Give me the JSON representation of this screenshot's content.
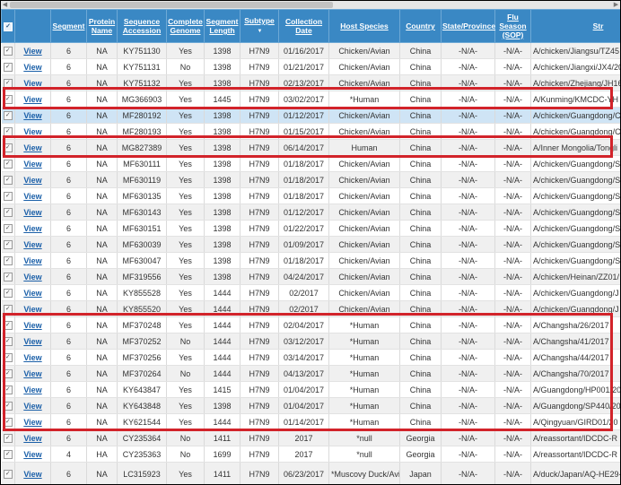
{
  "header": {
    "check_all_symbol": "✓",
    "columns": [
      {
        "key": "segment",
        "label": "Segment"
      },
      {
        "key": "protein",
        "label": "Protein Name"
      },
      {
        "key": "accession",
        "label": "Sequence Accession"
      },
      {
        "key": "complete",
        "label": "Complete Genome"
      },
      {
        "key": "length",
        "label": "Segment Length"
      },
      {
        "key": "subtype",
        "label": "Subtype"
      },
      {
        "key": "date",
        "label": "Collection Date"
      },
      {
        "key": "host",
        "label": "Host Species"
      },
      {
        "key": "country",
        "label": "Country"
      },
      {
        "key": "state",
        "label": "State/Province"
      },
      {
        "key": "season",
        "label": "Flu Season (SOP)"
      },
      {
        "key": "strain",
        "label": "Str"
      }
    ],
    "sort_icon": "▼"
  },
  "row_check_symbol": "✓",
  "view_label": "View",
  "colors": {
    "header_bg": "#3a88c4",
    "highlight_border": "#d2232a",
    "selected_row": "#cfe4f5",
    "link": "#1a5fa8"
  },
  "rows": [
    {
      "segment": "6",
      "protein": "NA",
      "accession": "KY751130",
      "complete": "Yes",
      "length": "1398",
      "subtype": "H7N9",
      "date": "01/16/2017",
      "host": "Chicken/Avian",
      "country": "China",
      "state": "-N/A-",
      "season": "-N/A-",
      "strain": "A/chicken/Jiangsu/TZ45"
    },
    {
      "segment": "6",
      "protein": "NA",
      "accession": "KY751131",
      "complete": "No",
      "length": "1398",
      "subtype": "H7N9",
      "date": "01/21/2017",
      "host": "Chicken/Avian",
      "country": "China",
      "state": "-N/A-",
      "season": "-N/A-",
      "strain": "A/chicken/Jiangxi/JX4/20"
    },
    {
      "segment": "6",
      "protein": "NA",
      "accession": "KY751132",
      "complete": "Yes",
      "length": "1398",
      "subtype": "H7N9",
      "date": "02/13/2017",
      "host": "Chicken/Avian",
      "country": "China",
      "state": "-N/A-",
      "season": "-N/A-",
      "strain": "A/chicken/Zhejiang/JH16"
    },
    {
      "segment": "6",
      "protein": "NA",
      "accession": "MG366903",
      "complete": "Yes",
      "length": "1445",
      "subtype": "H7N9",
      "date": "03/02/2017",
      "host": "*Human",
      "country": "China",
      "state": "-N/A-",
      "season": "-N/A-",
      "strain": "A/Kunming/KMCDC-YH"
    },
    {
      "segment": "6",
      "protein": "NA",
      "accession": "MF280192",
      "complete": "Yes",
      "length": "1398",
      "subtype": "H7N9",
      "date": "01/12/2017",
      "host": "Chicken/Avian",
      "country": "China",
      "state": "-N/A-",
      "season": "-N/A-",
      "strain": "A/chicken/Guangdong/C",
      "selected": true
    },
    {
      "segment": "6",
      "protein": "NA",
      "accession": "MF280193",
      "complete": "Yes",
      "length": "1398",
      "subtype": "H7N9",
      "date": "01/15/2017",
      "host": "Chicken/Avian",
      "country": "China",
      "state": "-N/A-",
      "season": "-N/A-",
      "strain": "A/chicken/Guangdong/C"
    },
    {
      "segment": "6",
      "protein": "NA",
      "accession": "MG827389",
      "complete": "Yes",
      "length": "1398",
      "subtype": "H7N9",
      "date": "06/14/2017",
      "host": "Human",
      "country": "China",
      "state": "-N/A-",
      "season": "-N/A-",
      "strain": "A/Inner Mongolia/Tongli"
    },
    {
      "segment": "6",
      "protein": "NA",
      "accession": "MF630111",
      "complete": "Yes",
      "length": "1398",
      "subtype": "H7N9",
      "date": "01/18/2017",
      "host": "Chicken/Avian",
      "country": "China",
      "state": "-N/A-",
      "season": "-N/A-",
      "strain": "A/chicken/Guangdong/S"
    },
    {
      "segment": "6",
      "protein": "NA",
      "accession": "MF630119",
      "complete": "Yes",
      "length": "1398",
      "subtype": "H7N9",
      "date": "01/18/2017",
      "host": "Chicken/Avian",
      "country": "China",
      "state": "-N/A-",
      "season": "-N/A-",
      "strain": "A/chicken/Guangdong/S"
    },
    {
      "segment": "6",
      "protein": "NA",
      "accession": "MF630135",
      "complete": "Yes",
      "length": "1398",
      "subtype": "H7N9",
      "date": "01/18/2017",
      "host": "Chicken/Avian",
      "country": "China",
      "state": "-N/A-",
      "season": "-N/A-",
      "strain": "A/chicken/Guangdong/S"
    },
    {
      "segment": "6",
      "protein": "NA",
      "accession": "MF630143",
      "complete": "Yes",
      "length": "1398",
      "subtype": "H7N9",
      "date": "01/12/2017",
      "host": "Chicken/Avian",
      "country": "China",
      "state": "-N/A-",
      "season": "-N/A-",
      "strain": "A/chicken/Guangdong/S"
    },
    {
      "segment": "6",
      "protein": "NA",
      "accession": "MF630151",
      "complete": "Yes",
      "length": "1398",
      "subtype": "H7N9",
      "date": "01/22/2017",
      "host": "Chicken/Avian",
      "country": "China",
      "state": "-N/A-",
      "season": "-N/A-",
      "strain": "A/chicken/Guangdong/S"
    },
    {
      "segment": "6",
      "protein": "NA",
      "accession": "MF630039",
      "complete": "Yes",
      "length": "1398",
      "subtype": "H7N9",
      "date": "01/09/2017",
      "host": "Chicken/Avian",
      "country": "China",
      "state": "-N/A-",
      "season": "-N/A-",
      "strain": "A/chicken/Guangdong/S"
    },
    {
      "segment": "6",
      "protein": "NA",
      "accession": "MF630047",
      "complete": "Yes",
      "length": "1398",
      "subtype": "H7N9",
      "date": "01/18/2017",
      "host": "Chicken/Avian",
      "country": "China",
      "state": "-N/A-",
      "season": "-N/A-",
      "strain": "A/chicken/Guangdong/S"
    },
    {
      "segment": "6",
      "protein": "NA",
      "accession": "MF319556",
      "complete": "Yes",
      "length": "1398",
      "subtype": "H7N9",
      "date": "04/24/2017",
      "host": "Chicken/Avian",
      "country": "China",
      "state": "-N/A-",
      "season": "-N/A-",
      "strain": "A/chicken/Heinan/ZZ01/"
    },
    {
      "segment": "6",
      "protein": "NA",
      "accession": "KY855528",
      "complete": "Yes",
      "length": "1444",
      "subtype": "H7N9",
      "date": "02/2017",
      "host": "Chicken/Avian",
      "country": "China",
      "state": "-N/A-",
      "season": "-N/A-",
      "strain": "A/chicken/Guangdong/J"
    },
    {
      "segment": "6",
      "protein": "NA",
      "accession": "KY855520",
      "complete": "Yes",
      "length": "1444",
      "subtype": "H7N9",
      "date": "02/2017",
      "host": "Chicken/Avian",
      "country": "China",
      "state": "-N/A-",
      "season": "-N/A-",
      "strain": "A/chicken/Guangdong/J"
    },
    {
      "segment": "6",
      "protein": "NA",
      "accession": "MF370248",
      "complete": "Yes",
      "length": "1444",
      "subtype": "H7N9",
      "date": "02/04/2017",
      "host": "*Human",
      "country": "China",
      "state": "-N/A-",
      "season": "-N/A-",
      "strain": "A/Changsha/26/2017"
    },
    {
      "segment": "6",
      "protein": "NA",
      "accession": "MF370252",
      "complete": "No",
      "length": "1444",
      "subtype": "H7N9",
      "date": "03/12/2017",
      "host": "*Human",
      "country": "China",
      "state": "-N/A-",
      "season": "-N/A-",
      "strain": "A/Changsha/41/2017"
    },
    {
      "segment": "6",
      "protein": "NA",
      "accession": "MF370256",
      "complete": "Yes",
      "length": "1444",
      "subtype": "H7N9",
      "date": "03/14/2017",
      "host": "*Human",
      "country": "China",
      "state": "-N/A-",
      "season": "-N/A-",
      "strain": "A/Changsha/44/2017"
    },
    {
      "segment": "6",
      "protein": "NA",
      "accession": "MF370264",
      "complete": "No",
      "length": "1444",
      "subtype": "H7N9",
      "date": "04/13/2017",
      "host": "*Human",
      "country": "China",
      "state": "-N/A-",
      "season": "-N/A-",
      "strain": "A/Changsha/70/2017"
    },
    {
      "segment": "6",
      "protein": "NA",
      "accession": "KY643847",
      "complete": "Yes",
      "length": "1415",
      "subtype": "H7N9",
      "date": "01/04/2017",
      "host": "*Human",
      "country": "China",
      "state": "-N/A-",
      "season": "-N/A-",
      "strain": "A/Guangdong/HP001/20"
    },
    {
      "segment": "6",
      "protein": "NA",
      "accession": "KY643848",
      "complete": "Yes",
      "length": "1398",
      "subtype": "H7N9",
      "date": "01/04/2017",
      "host": "*Human",
      "country": "China",
      "state": "-N/A-",
      "season": "-N/A-",
      "strain": "A/Guangdong/SP440/20"
    },
    {
      "segment": "6",
      "protein": "NA",
      "accession": "KY621544",
      "complete": "Yes",
      "length": "1444",
      "subtype": "H7N9",
      "date": "01/14/2017",
      "host": "*Human",
      "country": "China",
      "state": "-N/A-",
      "season": "-N/A-",
      "strain": "A/Qingyuan/GIRD01/20"
    },
    {
      "segment": "6",
      "protein": "NA",
      "accession": "CY235364",
      "complete": "No",
      "length": "1411",
      "subtype": "H7N9",
      "date": "2017",
      "host": "*null",
      "country": "Georgia",
      "state": "-N/A-",
      "season": "-N/A-",
      "strain": "A/reassortant/IDCDC-R"
    },
    {
      "segment": "4",
      "protein": "HA",
      "accession": "CY235363",
      "complete": "No",
      "length": "1699",
      "subtype": "H7N9",
      "date": "2017",
      "host": "*null",
      "country": "Georgia",
      "state": "-N/A-",
      "season": "-N/A-",
      "strain": "A/reassortant/IDCDC-R"
    },
    {
      "segment": "6",
      "protein": "NA",
      "accession": "LC315923",
      "complete": "Yes",
      "length": "1411",
      "subtype": "H7N9",
      "date": "06/23/2017",
      "host": "*Muscovy Duck/Avian",
      "country": "Japan",
      "state": "-N/A-",
      "season": "-N/A-",
      "strain": "A/duck/Japan/AQ-HE29-",
      "tall": true
    }
  ]
}
